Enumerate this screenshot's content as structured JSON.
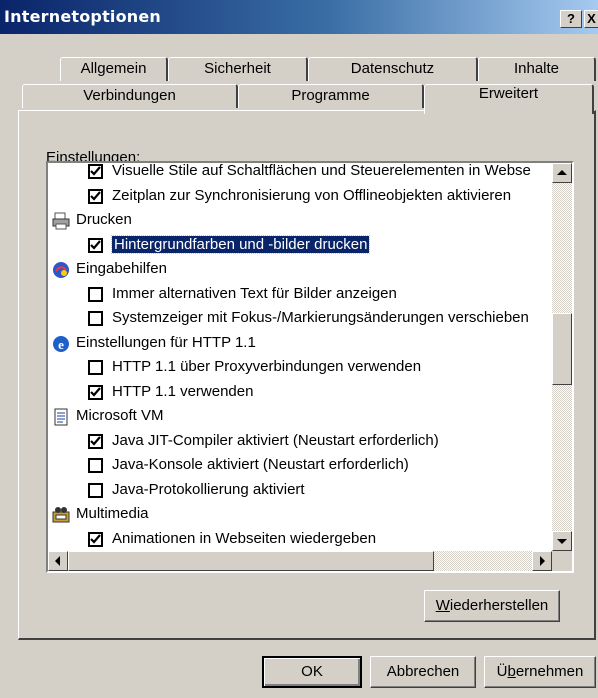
{
  "window": {
    "title": "Internetoptionen",
    "help_label": "?",
    "close_label": "X"
  },
  "tabs": {
    "row1": [
      "Allgemein",
      "Sicherheit",
      "Datenschutz",
      "Inhalte"
    ],
    "row2": [
      "Verbindungen",
      "Programme",
      "Erweitert"
    ],
    "selected": "Erweitert"
  },
  "settings": {
    "label_prefix": "E",
    "label_rest": "instellungen:",
    "items": [
      {
        "kind": "checkbox",
        "checked": true,
        "text": "Visuelle Stile auf Schaltflächen und Steuerelementen in Webse"
      },
      {
        "kind": "checkbox",
        "checked": true,
        "text": "Zeitplan zur Synchronisierung von Offlineobjekten aktivieren"
      },
      {
        "kind": "group",
        "icon": "printer-icon",
        "text": "Drucken"
      },
      {
        "kind": "checkbox",
        "checked": true,
        "selected": true,
        "text": "Hintergrundfarben und -bilder drucken"
      },
      {
        "kind": "group",
        "icon": "accessibility-icon",
        "text": "Eingabehilfen"
      },
      {
        "kind": "checkbox",
        "checked": false,
        "text": "Immer alternativen Text für Bilder anzeigen"
      },
      {
        "kind": "checkbox",
        "checked": false,
        "text": "Systemzeiger mit Fokus-/Markierungsänderungen verschieben"
      },
      {
        "kind": "group",
        "icon": "ie-icon",
        "text": "Einstellungen für HTTP 1.1"
      },
      {
        "kind": "checkbox",
        "checked": false,
        "text": "HTTP 1.1 über Proxyverbindungen verwenden"
      },
      {
        "kind": "checkbox",
        "checked": true,
        "text": "HTTP 1.1 verwenden"
      },
      {
        "kind": "group",
        "icon": "document-icon",
        "text": "Microsoft VM"
      },
      {
        "kind": "checkbox",
        "checked": true,
        "text": "Java JIT-Compiler aktiviert (Neustart erforderlich)"
      },
      {
        "kind": "checkbox",
        "checked": false,
        "text": "Java-Konsole aktiviert (Neustart erforderlich)"
      },
      {
        "kind": "checkbox",
        "checked": false,
        "text": "Java-Protokollierung aktiviert"
      },
      {
        "kind": "group",
        "icon": "multimedia-icon",
        "text": "Multimedia"
      },
      {
        "kind": "checkbox",
        "checked": true,
        "text": "Animationen in Webseiten wiedergeben"
      }
    ]
  },
  "buttons": {
    "restore_prefix": "W",
    "restore_rest": "iederherstellen",
    "ok": "OK",
    "cancel": "Abbrechen",
    "apply_pre": "Ü",
    "apply_underline": "b",
    "apply_rest": "ernehmen"
  },
  "colors": {
    "selection": "#0a246a",
    "titlebar_start": "#0a246a",
    "titlebar_end": "#a6caf0"
  }
}
